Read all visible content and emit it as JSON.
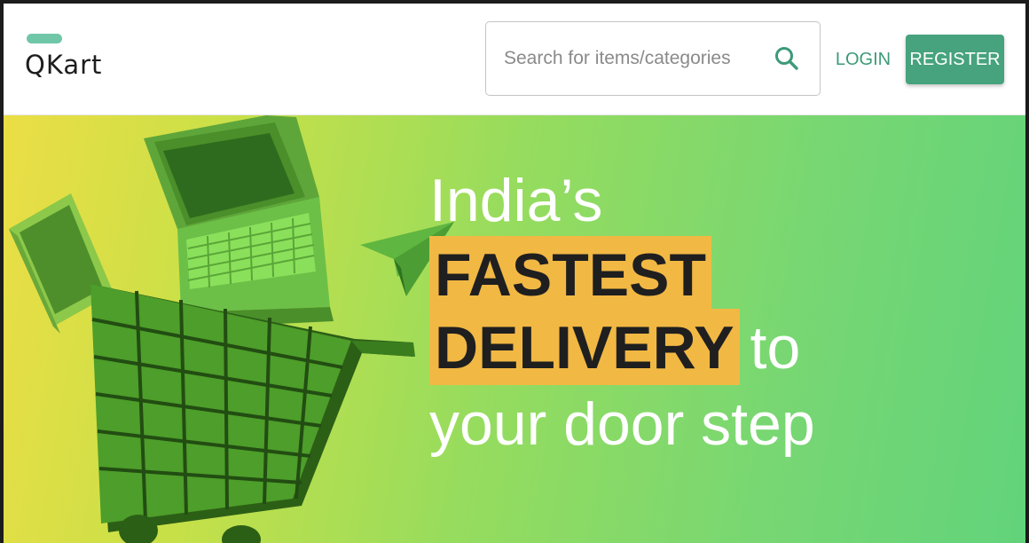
{
  "header": {
    "logo_text": "QKart",
    "search": {
      "placeholder": "Search for items/categories",
      "value": ""
    },
    "login_label": "LOGIN",
    "register_label": "REGISTER"
  },
  "hero": {
    "line1": "India’s",
    "highlight1": "FASTEST",
    "highlight2": "DELIVERY",
    "line3_suffix": "to",
    "line4": "your door step"
  },
  "colors": {
    "accent": "#46a37d",
    "login_text": "#3d9a78",
    "logo_bar": "#6fc7a8",
    "highlight": "#f2b844",
    "hero_gradient_start": "#ecde45",
    "hero_gradient_end": "#62d37b"
  },
  "icons": {
    "search": "search-icon",
    "illustration": [
      "tablet-icon",
      "laptop-icon",
      "paper-plane-icon",
      "shopping-cart-icon"
    ]
  }
}
